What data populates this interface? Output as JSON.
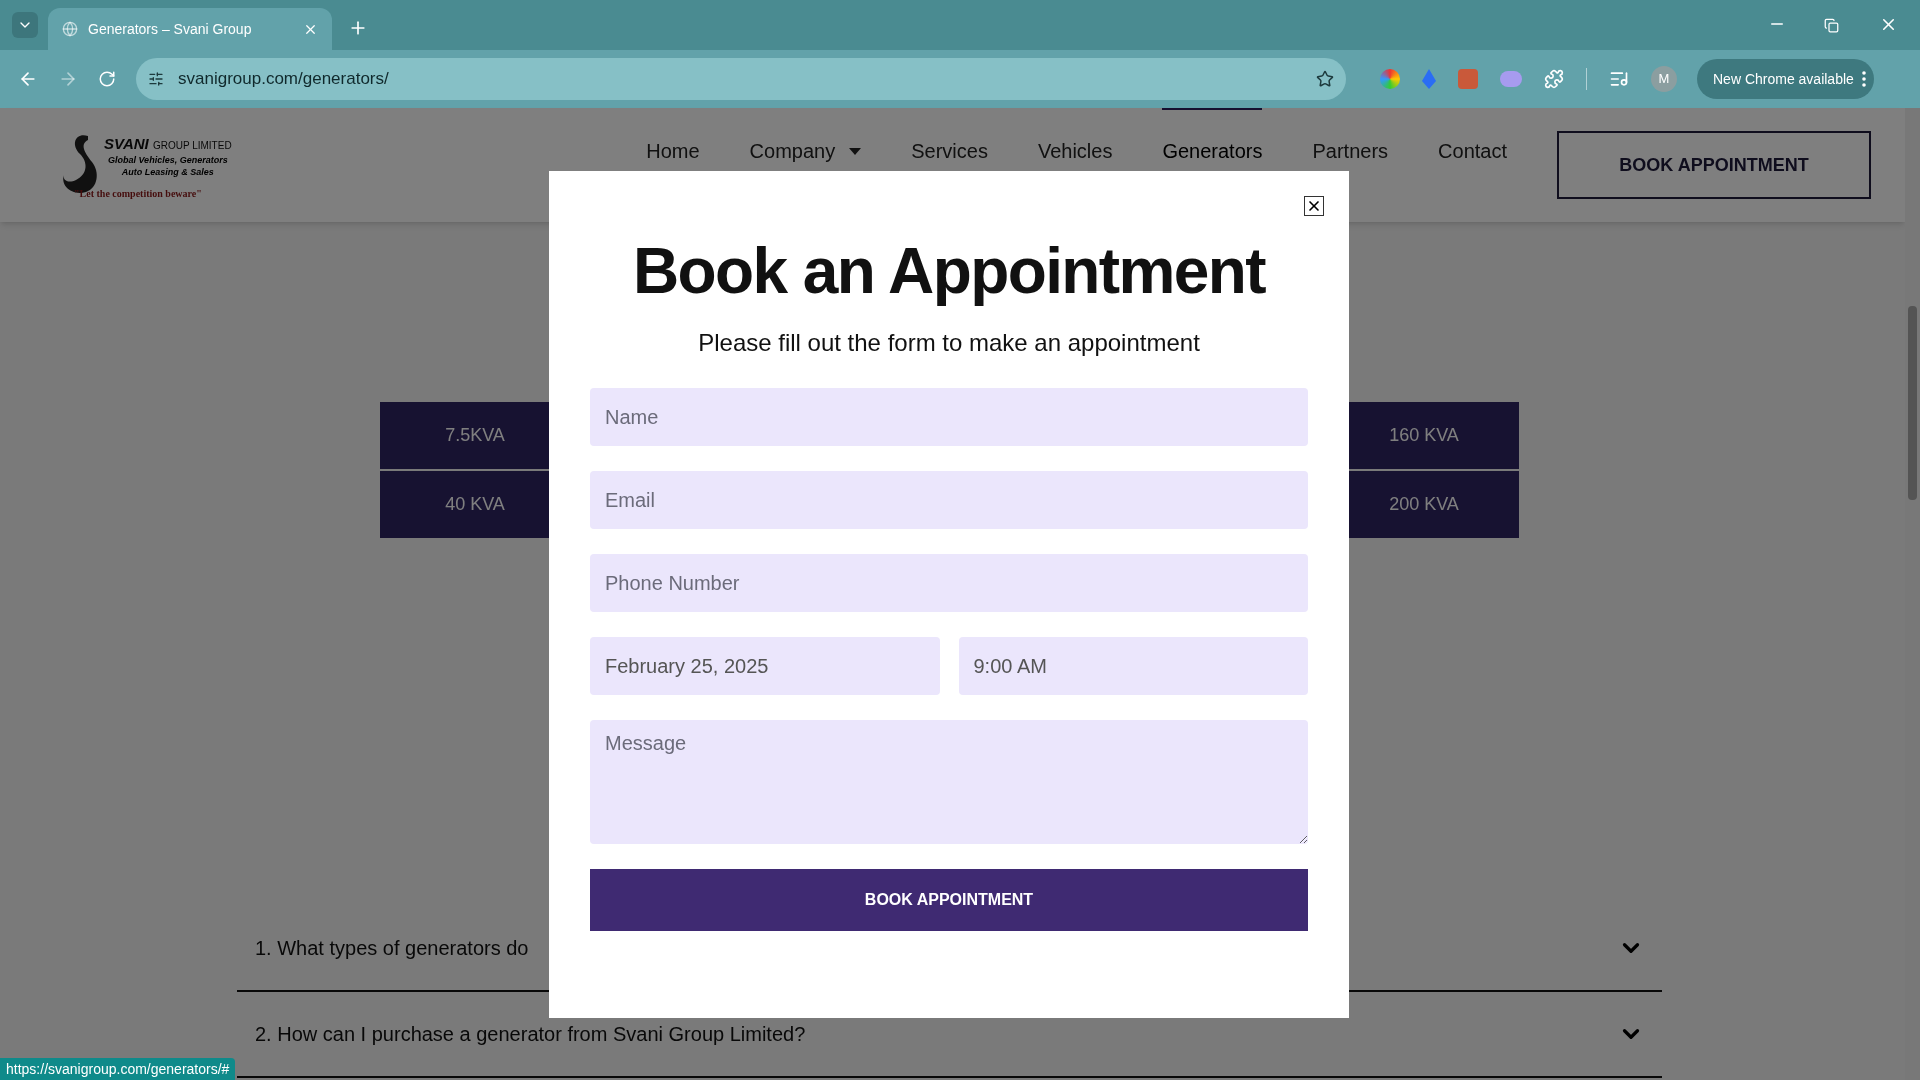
{
  "browser": {
    "tabs": [
      {
        "title": "Generators – Svani Group",
        "selected": true
      }
    ],
    "address": "svanigroup.com/generators/",
    "profile_initial": "M",
    "update_button": "New Chrome available"
  },
  "header": {
    "logo": {
      "name": "SVANI",
      "suffix": "GROUP LIMITED",
      "lines": [
        "Global Vehicles, Generators",
        "Auto Leasing & Sales"
      ],
      "tagline": "\"Let the competition beware\""
    },
    "nav": [
      {
        "label": "Home",
        "selected": false,
        "has_menu": false
      },
      {
        "label": "Company",
        "selected": false,
        "has_menu": true
      },
      {
        "label": "Services",
        "selected": false,
        "has_menu": false
      },
      {
        "label": "Vehicles",
        "selected": false,
        "has_menu": false
      },
      {
        "label": "Generators",
        "selected": true,
        "has_menu": false
      },
      {
        "label": "Partners",
        "selected": false,
        "has_menu": false
      },
      {
        "label": "Contact",
        "selected": false,
        "has_menu": false
      }
    ],
    "cta": "BOOK APPOINTMENT"
  },
  "table": {
    "rows": [
      [
        "7.5KVA",
        "160 KVA"
      ],
      [
        "40 KVA",
        "200 KVA"
      ]
    ]
  },
  "faq": [
    {
      "question": "1. What types of generators do",
      "expanded": false
    },
    {
      "question": "2. How can I purchase a generator from Svani Group Limited?",
      "expanded": false
    }
  ],
  "modal": {
    "title": "Book an Appointment",
    "subtitle": "Please fill out the form to make an appointment",
    "fields": [
      {
        "kind": "text",
        "placeholder": "Name"
      },
      {
        "kind": "text",
        "placeholder": "Email"
      },
      {
        "kind": "text",
        "placeholder": "Phone Number"
      }
    ],
    "date": "February 25, 2025",
    "time": "9:00 AM",
    "message_placeholder": "Message",
    "submit": "BOOK APPOINTMENT"
  },
  "status_url": "https://svanigroup.com/generators/#"
}
